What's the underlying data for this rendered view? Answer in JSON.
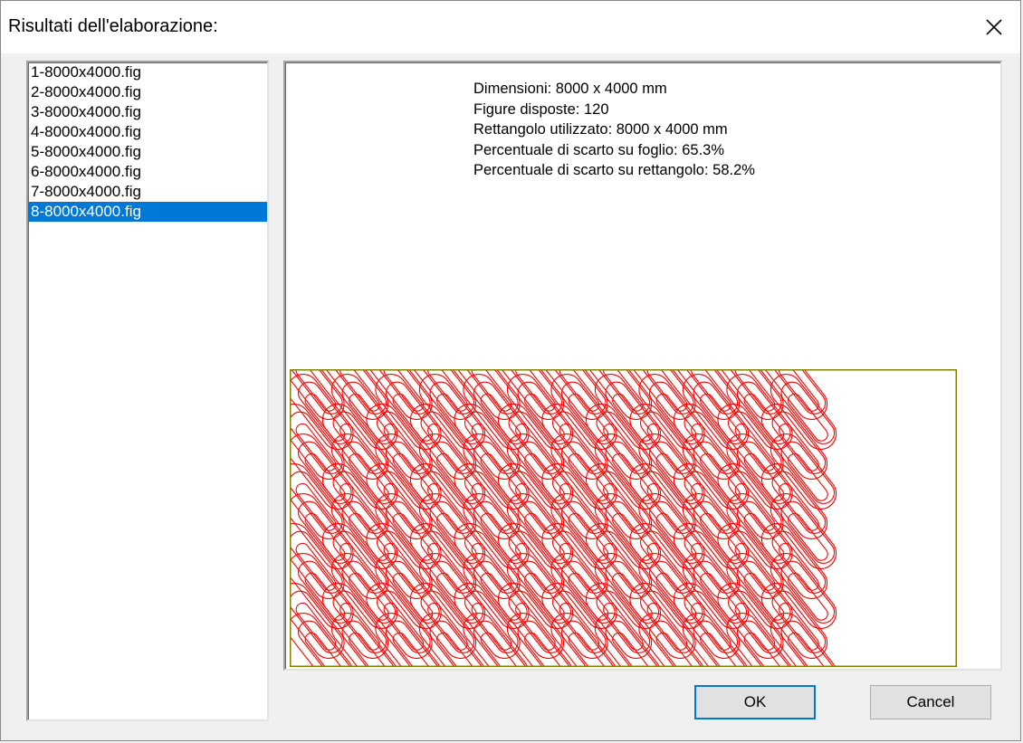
{
  "window": {
    "title": "Risultati dell'elaborazione:"
  },
  "file_list": {
    "items": [
      {
        "label": "1-8000x4000.fig",
        "selected": false
      },
      {
        "label": "2-8000x4000.fig",
        "selected": false
      },
      {
        "label": "3-8000x4000.fig",
        "selected": false
      },
      {
        "label": "4-8000x4000.fig",
        "selected": false
      },
      {
        "label": "5-8000x4000.fig",
        "selected": false
      },
      {
        "label": "6-8000x4000.fig",
        "selected": false
      },
      {
        "label": "7-8000x4000.fig",
        "selected": false
      },
      {
        "label": "8-8000x4000.fig",
        "selected": true
      }
    ]
  },
  "info": {
    "dimensions": "Dimensioni: 8000 x 4000 mm",
    "figures": "Figure disposte: 120",
    "rectangle": "Rettangolo utilizzato: 8000 x 4000 mm",
    "waste_sheet": "Percentuale di scarto su foglio: 65.3%",
    "waste_rect": "Percentuale di scarto su rettangolo: 58.2%"
  },
  "buttons": {
    "ok": "OK",
    "cancel": "Cancel"
  },
  "colors": {
    "selection": "#0078d7",
    "figure_stroke": "#ff0000",
    "sheet_border": "#808000"
  },
  "icons": {
    "close": "close-icon"
  }
}
